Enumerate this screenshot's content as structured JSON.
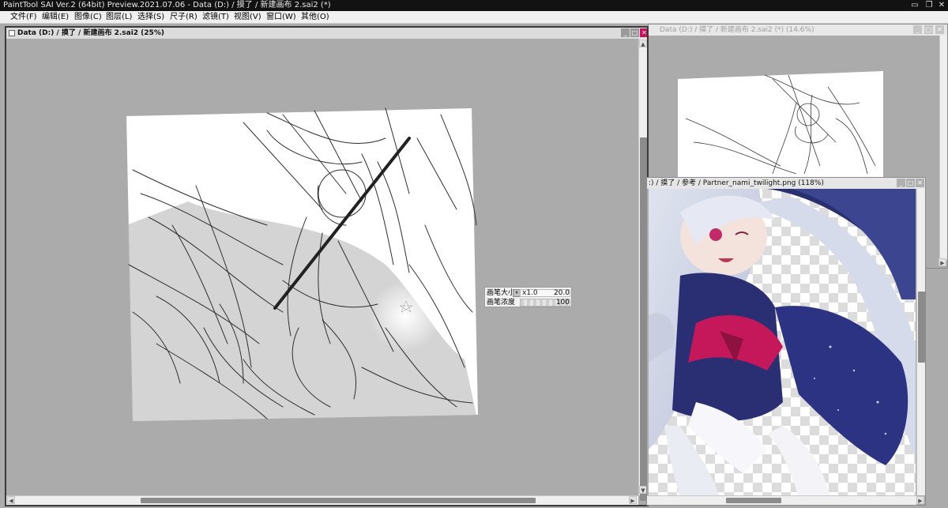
{
  "app": {
    "title": "PaintTool SAI Ver.2 (64bit) Preview.2021.07.06 - Data (D:) / 摸了 / 新建画布 2.sai2 (*)",
    "window_buttons": {
      "minimize": "▭",
      "maximize": "❐",
      "close": "✕"
    }
  },
  "menu": [
    "文件(F)",
    "编辑(E)",
    "图像(C)",
    "图层(L)",
    "选择(S)",
    "尺子(R)",
    "滤镜(T)",
    "视图(V)",
    "窗口(W)",
    "其他(O)"
  ],
  "doc_main": {
    "title": "Data (D:) / 摸了 / 新建画布 2.sai2 (25%)",
    "buttons": {
      "minimize": "_",
      "maximize": "□",
      "close": "✕"
    }
  },
  "doc_bg": {
    "title": "Data (D:) / 摸了 / 新建画布 2.sai2 (*) (14.6%)"
  },
  "doc_ref": {
    "title": ":) / 摸了 / 参考 / Partner_nami_twilight.png (118%)",
    "buttons": {
      "minimize": "_",
      "maximize": "□",
      "close": "✕"
    }
  },
  "brush_panel": {
    "size_label": "画笔大小",
    "size_multiplier": "x1.0",
    "size_value": "20.0",
    "density_label": "画笔浓度",
    "density_value": "100"
  },
  "icons": {
    "scroll_up": "▲",
    "scroll_down": "▼",
    "scroll_left": "◀",
    "scroll_right": "▶"
  },
  "colors": {
    "canvas_bg": "#ababab",
    "title_bar": "#121212",
    "close_accent": "#c8105a",
    "ref_navy": "#2a2f74",
    "ref_ribbon": "#c4185b"
  }
}
